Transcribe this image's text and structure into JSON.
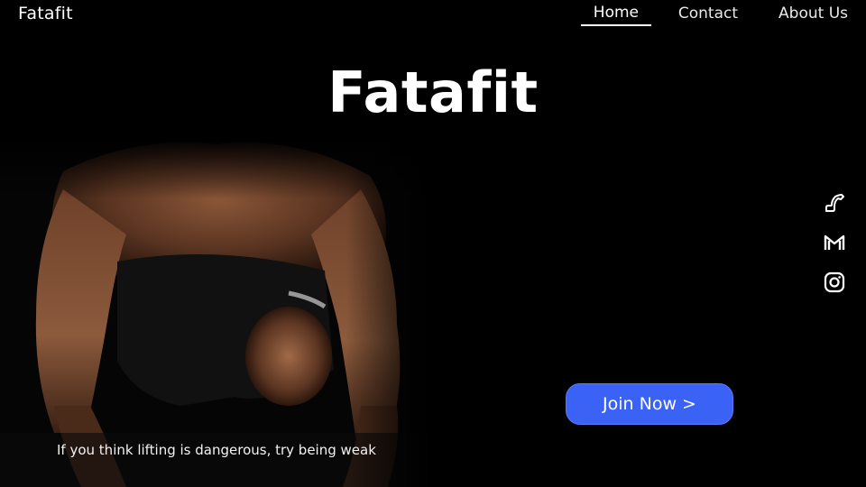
{
  "header": {
    "brand": "Fatafit",
    "nav": [
      {
        "label": "Home",
        "active": true
      },
      {
        "label": "Contact",
        "active": false
      },
      {
        "label": "About Us",
        "active": false
      }
    ]
  },
  "hero": {
    "title": "Fatafit",
    "tagline": "If you think lifting is dangerous, try being weak",
    "cta_label": "Join Now >"
  },
  "social": {
    "icons": [
      "phone-icon",
      "gmail-icon",
      "instagram-icon"
    ]
  },
  "colors": {
    "background": "#000000",
    "cta": "#3a63f5",
    "text": "#ffffff"
  }
}
